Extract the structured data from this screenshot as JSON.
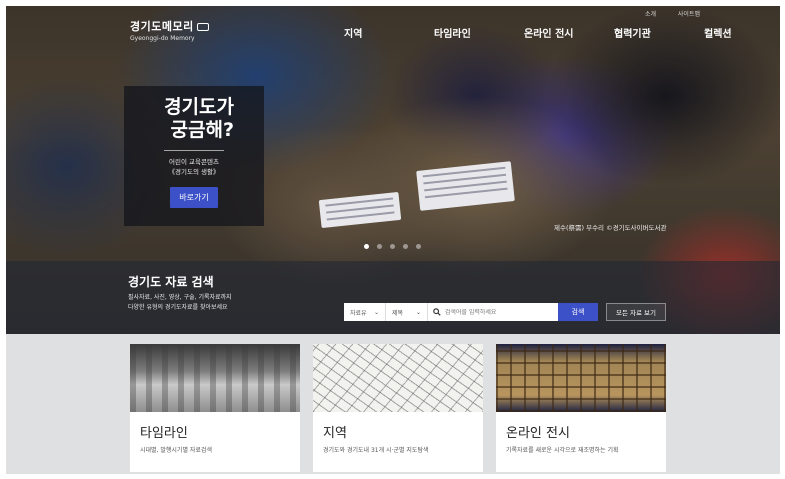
{
  "header": {
    "logo_title": "경기도메모리",
    "logo_sub": "Gyeonggi-do Memory",
    "utility": [
      "소개",
      "사이트맵"
    ],
    "nav": [
      "지역",
      "타임라인",
      "온라인 전시",
      "협력기관",
      "컬렉션"
    ]
  },
  "promo": {
    "title_line1": "경기도가",
    "title_line2": "궁금해?",
    "sub_line1": "어린이 교육콘텐츠",
    "sub_line2": "《경기도의 생활》",
    "button": "바로가기"
  },
  "hero": {
    "caption": "제수(祭需) 부수리 ©경기도사이버도서관",
    "slide_count": 5,
    "active_slide": 1
  },
  "search": {
    "title": "경기도 자료 검색",
    "desc_line1": "필사자료, 사진, 영상, 구술, 기록자료까지",
    "desc_line2": "다양한 유형의 경기도자료를 찾아보세요",
    "select1": "자료유",
    "select2": "제목",
    "input_placeholder": "검색어를 입력하세요",
    "button": "검색",
    "all_button": "모든 자료 보기"
  },
  "cards": [
    {
      "title": "타임라인",
      "desc": "시대별, 발행시기별 자료검색",
      "icon": "classroom-photo"
    },
    {
      "title": "지역",
      "desc": "경기도와 경기도내 31개 시·군별 지도탐색",
      "icon": "map-drawing"
    },
    {
      "title": "온라인 전시",
      "desc": "기록자료를 새로운 시각으로 재조명하는 기획",
      "icon": "exhibition-board"
    }
  ],
  "colors": {
    "accent_blue": "#3c50c8",
    "lower_bg": "#dfe0e2"
  }
}
